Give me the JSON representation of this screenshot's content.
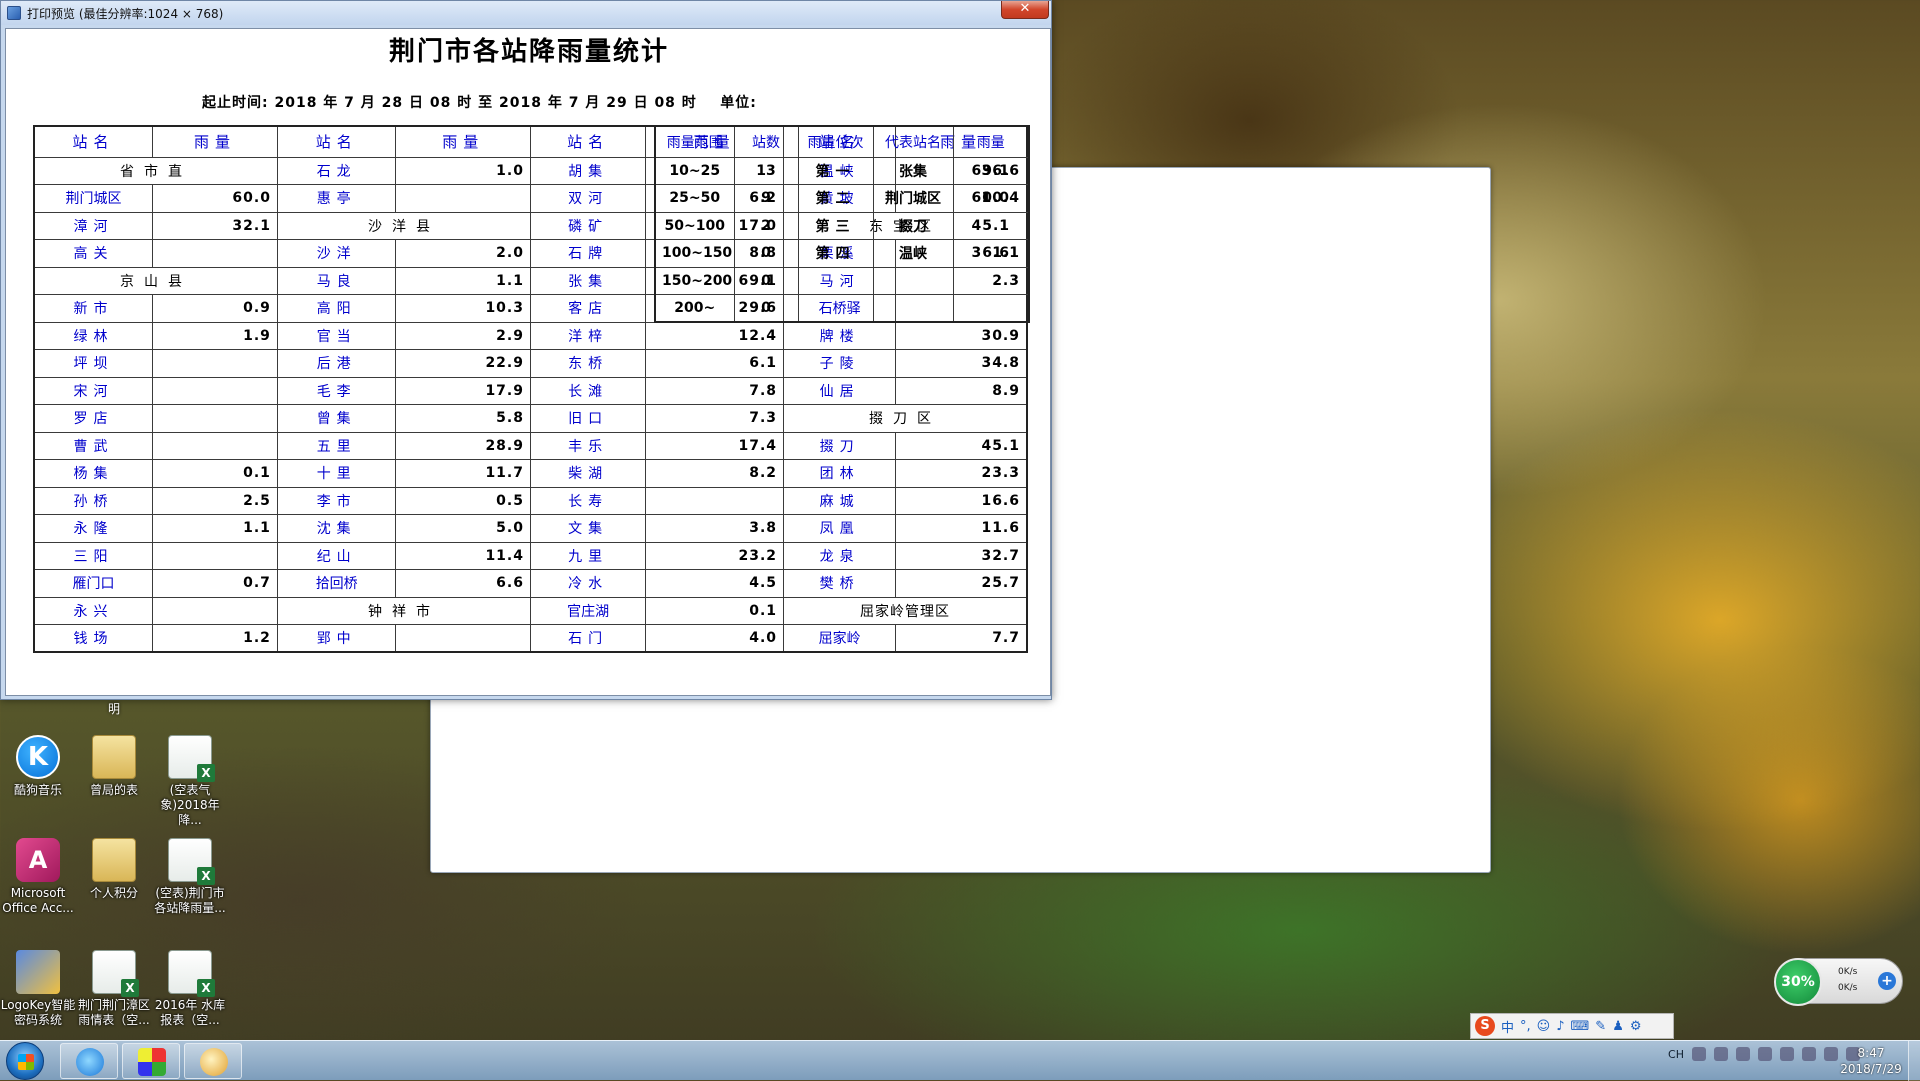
{
  "window": {
    "title": "打印预览 (最佳分辨率:1024 × 768)",
    "close_label": "✕"
  },
  "report": {
    "title": "荆门市各站降雨量统计",
    "period": "起止时间: 2018 年 7 月 28 日 08 时 至 2018 年 7 月 29 日 08 时    单位:"
  },
  "table": {
    "headers": {
      "station": "站名",
      "rain": "雨量"
    },
    "rows": [
      [
        {
          "t": "county",
          "v": "省市直"
        },
        {
          "n": "石龙",
          "v": "1.0"
        },
        {
          "n": "胡集",
          "v": ""
        },
        {
          "n": "温峡",
          "v": "36.6"
        }
      ],
      [
        {
          "n": "荆门城区",
          "v": "60.0"
        },
        {
          "n": "惠亭",
          "v": ""
        },
        {
          "n": "双河",
          "v": "6.2"
        },
        {
          "n": "黄坡",
          "v": "10.4"
        }
      ],
      [
        {
          "n": "漳河",
          "v": "32.1"
        },
        {
          "t": "county",
          "v": "沙洋县"
        },
        {
          "n": "磷矿",
          "v": "17.0"
        },
        {
          "t": "county",
          "v": "东宝区"
        }
      ],
      [
        {
          "n": "高关",
          "v": ""
        },
        {
          "n": "沙洋",
          "v": "2.0"
        },
        {
          "n": "石牌",
          "v": "8.8"
        },
        {
          "n": "栗溪",
          "v": "1.1"
        }
      ],
      [
        {
          "t": "county",
          "v": "京山县"
        },
        {
          "n": "马良",
          "v": "1.1"
        },
        {
          "n": "张集",
          "v": "69.1"
        },
        {
          "n": "马河",
          "v": "2.3"
        }
      ],
      [
        {
          "n": "新市",
          "v": "0.9"
        },
        {
          "n": "高阳",
          "v": "10.3"
        },
        {
          "n": "客店",
          "v": "29.6"
        },
        {
          "n": "石桥驿",
          "v": ""
        }
      ],
      [
        {
          "n": "绿林",
          "v": "1.9"
        },
        {
          "n": "官当",
          "v": "2.9"
        },
        {
          "n": "洋梓",
          "v": "12.4"
        },
        {
          "n": "牌楼",
          "v": "30.9"
        }
      ],
      [
        {
          "n": "坪坝",
          "v": ""
        },
        {
          "n": "后港",
          "v": "22.9"
        },
        {
          "n": "东桥",
          "v": "6.1"
        },
        {
          "n": "子陵",
          "v": "34.8"
        }
      ],
      [
        {
          "n": "宋河",
          "v": ""
        },
        {
          "n": "毛李",
          "v": "17.9"
        },
        {
          "n": "长滩",
          "v": "7.8"
        },
        {
          "n": "仙居",
          "v": "8.9"
        }
      ],
      [
        {
          "n": "罗店",
          "v": ""
        },
        {
          "n": "曾集",
          "v": "5.8"
        },
        {
          "n": "旧口",
          "v": "7.3"
        },
        {
          "t": "county",
          "v": "掇刀区"
        }
      ],
      [
        {
          "n": "曹武",
          "v": ""
        },
        {
          "n": "五里",
          "v": "28.9"
        },
        {
          "n": "丰乐",
          "v": "17.4"
        },
        {
          "n": "掇刀",
          "v": "45.1"
        }
      ],
      [
        {
          "n": "杨集",
          "v": "0.1"
        },
        {
          "n": "十里",
          "v": "11.7"
        },
        {
          "n": "柴湖",
          "v": "8.2"
        },
        {
          "n": "团林",
          "v": "23.3"
        }
      ],
      [
        {
          "n": "孙桥",
          "v": "2.5"
        },
        {
          "n": "李市",
          "v": "0.5"
        },
        {
          "n": "长寿",
          "v": ""
        },
        {
          "n": "麻城",
          "v": "16.6"
        }
      ],
      [
        {
          "n": "永隆",
          "v": "1.1"
        },
        {
          "n": "沈集",
          "v": "5.0"
        },
        {
          "n": "文集",
          "v": "3.8"
        },
        {
          "n": "凤凰",
          "v": "11.6"
        }
      ],
      [
        {
          "n": "三阳",
          "v": ""
        },
        {
          "n": "纪山",
          "v": "11.4"
        },
        {
          "n": "九里",
          "v": "23.2"
        },
        {
          "n": "龙泉",
          "v": "32.7"
        }
      ],
      [
        {
          "n": "雁门口",
          "v": "0.7"
        },
        {
          "n": "拾回桥",
          "v": "6.6"
        },
        {
          "n": "冷水",
          "v": "4.5"
        },
        {
          "n": "樊桥",
          "v": "25.7"
        }
      ],
      [
        {
          "n": "永兴",
          "v": ""
        },
        {
          "t": "county",
          "v": "钟祥市"
        },
        {
          "n": "官庄湖",
          "v": "0.1"
        },
        {
          "t": "county",
          "v": "屈家岭管理区"
        }
      ],
      [
        {
          "n": "钱场",
          "v": "1.2"
        },
        {
          "n": "郢中",
          "v": ""
        },
        {
          "n": "石门",
          "v": "4.0"
        },
        {
          "n": "屈家岭",
          "v": "7.7"
        }
      ]
    ]
  },
  "summary": {
    "headers": [
      "雨量范围",
      "站数",
      "雨量位次",
      "代表站名",
      "雨量"
    ],
    "rows": [
      [
        "10~25",
        "13",
        "第一",
        "张集",
        "69.1"
      ],
      [
        "25~50",
        "9",
        "第二",
        "荆门城区",
        "60.0"
      ],
      [
        "50~100",
        "2",
        "第三",
        "掇刀",
        "45.1"
      ],
      [
        "100~150",
        "0",
        "第四",
        "温峡",
        "36.6"
      ],
      [
        "150~200",
        "0",
        "",
        "",
        ""
      ],
      [
        "200~",
        "0",
        "",
        "",
        ""
      ]
    ]
  },
  "desktop": {
    "partial_label": "明",
    "icons": [
      {
        "label": "酷狗音乐",
        "glyph": "K"
      },
      {
        "label": "曾局的表"
      },
      {
        "label": "(空表气象)2018年降..."
      },
      {
        "label": "Microsoft Office Acc...",
        "glyph": "A"
      },
      {
        "label": "个人积分"
      },
      {
        "label": "(空表)荆门市各站降雨量..."
      },
      {
        "label": "LogoKey智能密码系统"
      },
      {
        "label": "荆门荆门漳区雨情表（空..."
      },
      {
        "label": "2016年 水库报表（空..."
      }
    ]
  },
  "widgets": {
    "speed_percent": "30%",
    "speed_up": "0K/s",
    "speed_down": "0K/s",
    "speed_plus": "+",
    "ime_logo": "S",
    "ime_items": [
      "中",
      "°,",
      "☺",
      "♪",
      "⌨",
      "✎",
      "♟",
      "⚙"
    ]
  },
  "taskbar": {
    "clock_time": "8:47",
    "clock_date": "2018/7/29",
    "tray_lang": "CH"
  }
}
